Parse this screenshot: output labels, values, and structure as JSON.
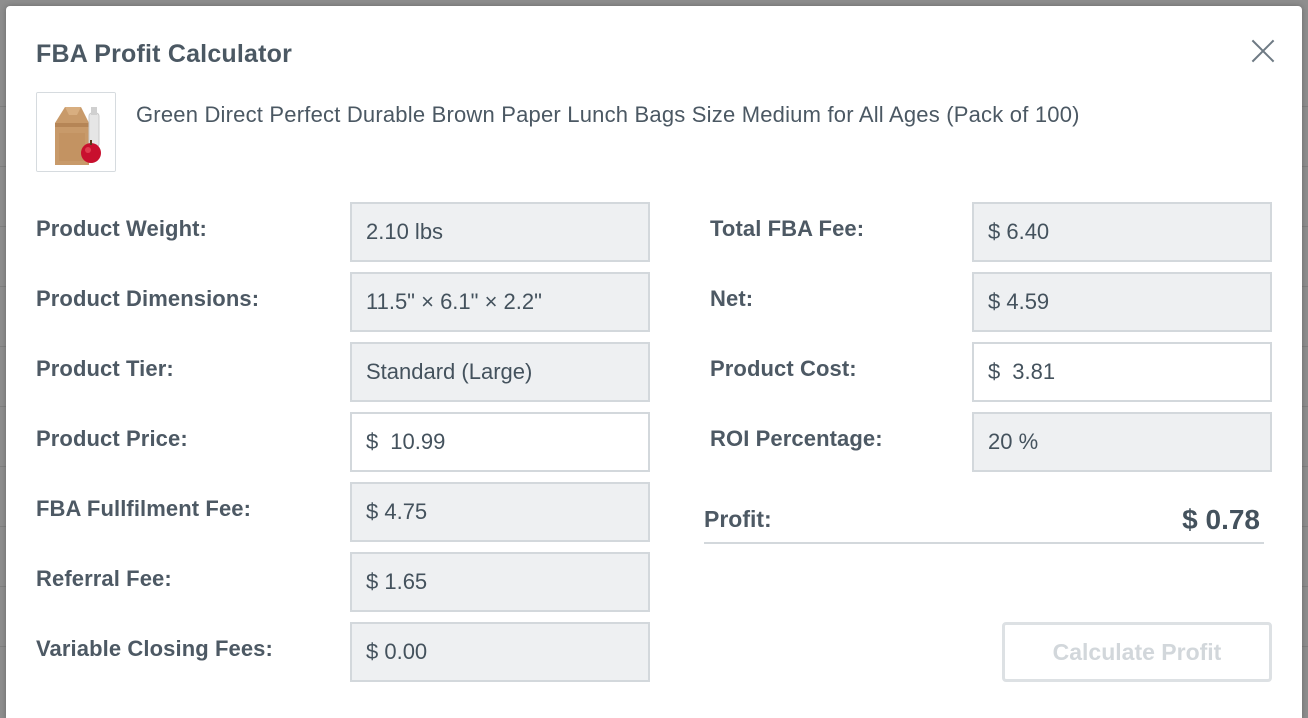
{
  "modal": {
    "title": "FBA Profit Calculator"
  },
  "product": {
    "title": "Green Direct Perfect Durable Brown Paper Lunch Bags Size Medium for All Ages (Pack of 100)"
  },
  "left_fields": [
    {
      "label": "Product Weight:",
      "value": "2.10 lbs"
    },
    {
      "label": "Product Dimensions:",
      "value": "11.5\" × 6.1\" × 2.2\""
    },
    {
      "label": "Product Tier:",
      "value": "Standard (Large)"
    },
    {
      "label": "Product Price:",
      "currency": "$",
      "value": "10.99"
    },
    {
      "label": "FBA Fullfilment Fee:",
      "value": "$ 4.75"
    },
    {
      "label": "Referral Fee:",
      "value": "$ 1.65"
    },
    {
      "label": "Variable Closing Fees:",
      "value": "$ 0.00"
    }
  ],
  "right_fields": [
    {
      "label": "Total FBA Fee:",
      "value": "$ 6.40"
    },
    {
      "label": "Net:",
      "value": "$ 4.59"
    },
    {
      "label": "Product Cost:",
      "currency": "$",
      "value": "3.81"
    },
    {
      "label": "ROI Percentage:",
      "value": "20 %"
    }
  ],
  "profit": {
    "label": "Profit:",
    "value": "$ 0.78"
  },
  "calculate_button": {
    "label": "Calculate Profit"
  },
  "colors": {
    "readonly_field_bg": "#eef0f2",
    "field_border": "#d3d8dc",
    "text": "#44525d",
    "disabled_button_text": "#d2d7db"
  }
}
